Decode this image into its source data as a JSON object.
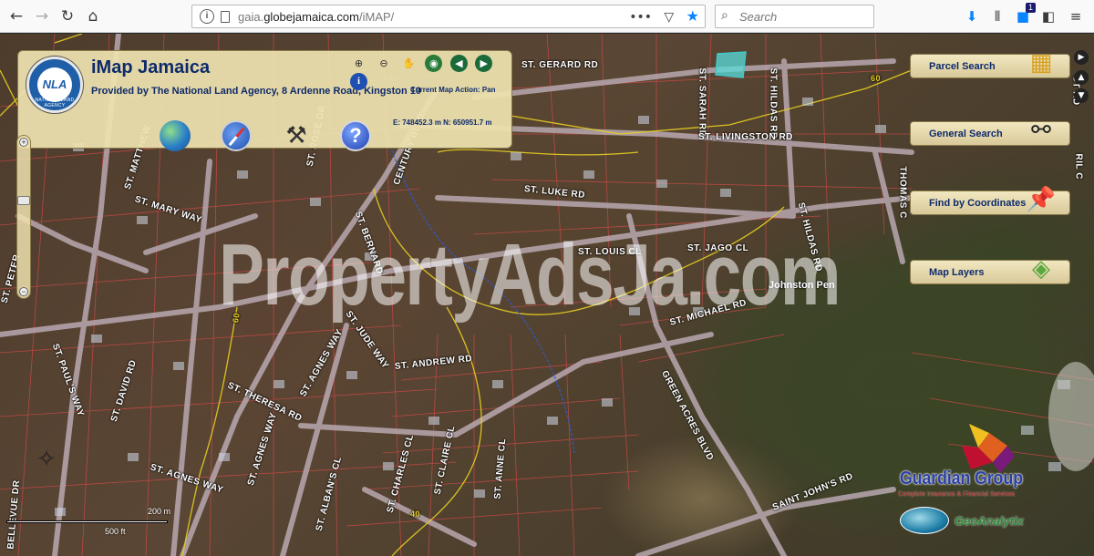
{
  "browser": {
    "url_prefix": "gaia.",
    "url_domain": "globejamaica.com",
    "url_path": "/iMAP/",
    "url_more": "•••",
    "search_placeholder": "Search",
    "notification_count": "1",
    "accent_color": "#0a84ff"
  },
  "panel": {
    "title": "iMap Jamaica",
    "provider": "Provided by The National Land Agency, 8 Ardenne Road, Kingston 10",
    "action_label": "Current Map Action: Pan",
    "coords": "E: 748452.3 m    N: 650951.7 m",
    "logo_text": "NLA",
    "logo_subtext": "NATIONAL LAND AGENCY"
  },
  "side_buttons": {
    "parcel_search": "Parcel Search",
    "general_search": "General Search",
    "find_coords": "Find by Coordinates",
    "map_layers": "Map Layers"
  },
  "map": {
    "watermark": "PropertyAdsJa.com",
    "place_label": "Johnston Pen",
    "roads": {
      "gerard": "ST. GERARD RD",
      "sarah": "ST. SARAH RD",
      "hildas1": "ST. HILDAS RD",
      "hildas2": "ST. HILDAS RD",
      "livingston": "ST. LIVINGSTON RD",
      "thomas": "THOMAS C",
      "matthew": "ST. MATTHEW",
      "mary": "ST. MARY WAY",
      "rose": "ST. ROSE DR",
      "bernard": "ST. BERNARD",
      "century": "CENTURY BLVD",
      "luke": "ST. LUKE RD",
      "louis": "ST. LOUIS CL",
      "jago": "ST. JAGO CL",
      "michael": "ST. MICHAEL RD",
      "jude": "ST. JUDE WAY",
      "andrew": "ST. ANDREW RD",
      "agnes1": "ST. AGNES WAY",
      "agnes2": "ST. AGNES WAY",
      "agnes3": "ST. AGNES WAY",
      "theresa": "ST. THERESA RD",
      "david": "ST. DAVID RD",
      "pauls": "ST. PAUL'S WAY",
      "peter": "ST. PETER",
      "albans": "ST. ALBAN'S CL",
      "charles": "ST. CHARLES CL",
      "claire": "ST. CLAIRE CL",
      "anne": "ST. ANNE CL",
      "green_acres": "GREEN ACRES BLVD",
      "saint_johns": "SAINT JOHN'S RD",
      "bellevue": "BELLEVUE DR",
      "bridge": "RIDGE",
      "dr_c": "CT RD",
      "ril": "RIL C",
      "label60": "60",
      "label40": "40"
    },
    "scale_metric": "200 m",
    "scale_imperial": "500 ft"
  },
  "sponsors": {
    "guardian_name": "Guardian Group",
    "guardian_tag": "Complete Insurance & Financial Services",
    "ga_name": "GeoAnalytix"
  },
  "colors": {
    "panel_bg": "#eee2af",
    "panel_text": "#0d2a6b",
    "parcel_line": "#e04040",
    "contour_line": "#e8d020",
    "road": "#b8a8b0"
  }
}
